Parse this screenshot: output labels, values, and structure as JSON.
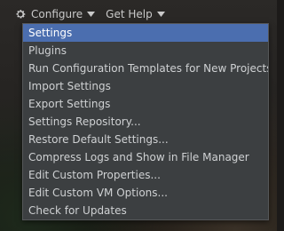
{
  "topbar": {
    "configure_label": "Configure",
    "gethelp_label": "Get Help"
  },
  "icons": {
    "configure": "gear-icon",
    "dropdown": "chevron-down-icon"
  },
  "colors": {
    "selection": "#4b6eaf",
    "menu_bg": "#3c3f41",
    "menu_text": "#cfd1d3"
  },
  "dropdown": {
    "selected_index": 0,
    "items": [
      {
        "label": "Settings"
      },
      {
        "label": "Plugins"
      },
      {
        "label": "Run Configuration Templates for New Projects..."
      },
      {
        "label": "Import Settings"
      },
      {
        "label": "Export Settings"
      },
      {
        "label": "Settings Repository..."
      },
      {
        "label": "Restore Default Settings..."
      },
      {
        "label": "Compress Logs and Show in File Manager"
      },
      {
        "label": "Edit Custom Properties..."
      },
      {
        "label": "Edit Custom VM Options..."
      },
      {
        "label": "Check for Updates"
      }
    ]
  }
}
